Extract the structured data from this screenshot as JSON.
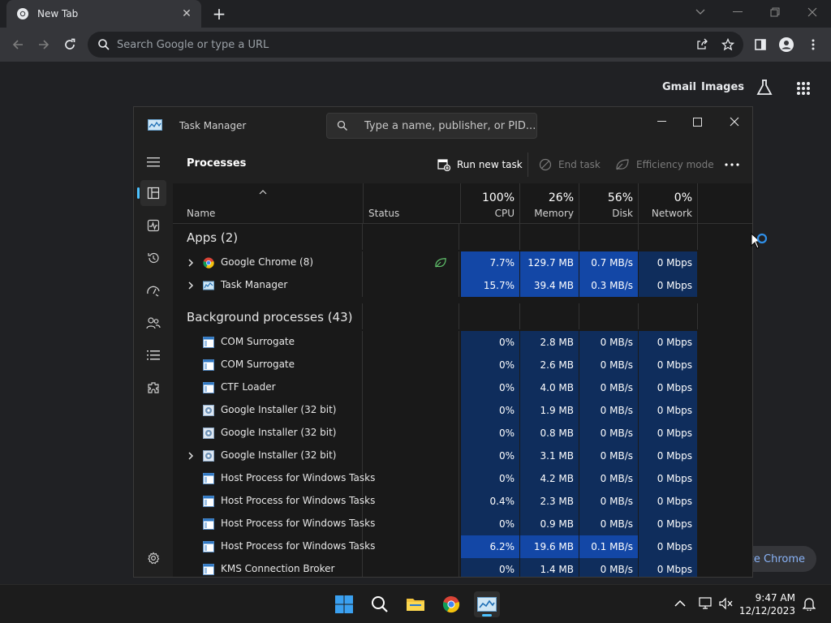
{
  "browser": {
    "tab_title": "New Tab",
    "omnibox_placeholder": "Search Google or type a URL",
    "ntp_links": [
      "Gmail",
      "Images"
    ],
    "customize_label": "ize Chrome"
  },
  "task_manager": {
    "title": "Task Manager",
    "search_placeholder": "Type a name, publisher, or PID...",
    "page_title": "Processes",
    "commands": {
      "run_new_task": "Run new task",
      "end_task": "End task",
      "efficiency_mode": "Efficiency mode"
    },
    "columns": {
      "name": "Name",
      "status": "Status",
      "cpu_pct": "100%",
      "cpu": "CPU",
      "memory_pct": "26%",
      "memory": "Memory",
      "disk_pct": "56%",
      "disk": "Disk",
      "network_pct": "0%",
      "network": "Network"
    },
    "apps_group": "Apps (2)",
    "bg_group": "Background processes (43)",
    "apps": [
      {
        "name": "Google Chrome (8)",
        "cpu": "7.7%",
        "memory": "129.7 MB",
        "disk": "0.7 MB/s",
        "network": "0 Mbps",
        "icon": "chrome-icon"
      },
      {
        "name": "Task Manager",
        "cpu": "15.7%",
        "memory": "39.4 MB",
        "disk": "0.3 MB/s",
        "network": "0 Mbps",
        "icon": "task-manager-icon"
      }
    ],
    "background": [
      {
        "name": "COM Surrogate",
        "cpu": "0%",
        "memory": "2.8 MB",
        "disk": "0 MB/s",
        "network": "0 Mbps"
      },
      {
        "name": "COM Surrogate",
        "cpu": "0%",
        "memory": "2.6 MB",
        "disk": "0 MB/s",
        "network": "0 Mbps"
      },
      {
        "name": "CTF Loader",
        "cpu": "0%",
        "memory": "4.0 MB",
        "disk": "0 MB/s",
        "network": "0 Mbps"
      },
      {
        "name": "Google Installer (32 bit)",
        "cpu": "0%",
        "memory": "1.9 MB",
        "disk": "0 MB/s",
        "network": "0 Mbps"
      },
      {
        "name": "Google Installer (32 bit)",
        "cpu": "0%",
        "memory": "0.8 MB",
        "disk": "0 MB/s",
        "network": "0 Mbps"
      },
      {
        "name": "Google Installer (32 bit)",
        "cpu": "0%",
        "memory": "3.1 MB",
        "disk": "0 MB/s",
        "network": "0 Mbps"
      },
      {
        "name": "Host Process for Windows Tasks",
        "cpu": "0%",
        "memory": "4.2 MB",
        "disk": "0 MB/s",
        "network": "0 Mbps"
      },
      {
        "name": "Host Process for Windows Tasks",
        "cpu": "0.4%",
        "memory": "2.3 MB",
        "disk": "0 MB/s",
        "network": "0 Mbps"
      },
      {
        "name": "Host Process for Windows Tasks",
        "cpu": "0%",
        "memory": "0.9 MB",
        "disk": "0 MB/s",
        "network": "0 Mbps"
      },
      {
        "name": "Host Process for Windows Tasks",
        "cpu": "6.2%",
        "memory": "19.6 MB",
        "disk": "0.1 MB/s",
        "network": "0 Mbps"
      },
      {
        "name": "KMS Connection Broker",
        "cpu": "0%",
        "memory": "1.4 MB",
        "disk": "0 MB/s",
        "network": "0 Mbps"
      }
    ]
  },
  "taskbar": {
    "time": "9:47 AM",
    "date": "12/12/2023"
  },
  "colors": {
    "accent": "#4cc2ff",
    "heat_low": "#0f2d5c",
    "heat_high": "#1347a6"
  }
}
